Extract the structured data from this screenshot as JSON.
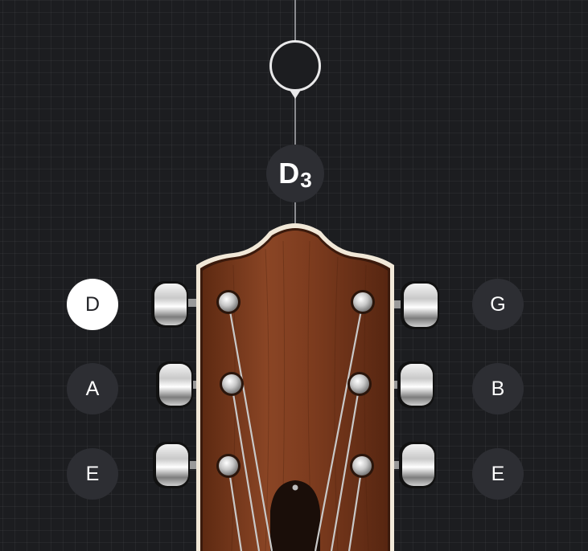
{
  "tuner": {
    "note": "D",
    "octave": "3"
  },
  "strings": {
    "left": [
      {
        "label": "D",
        "selected": true
      },
      {
        "label": "A",
        "selected": false
      },
      {
        "label": "E",
        "selected": false
      }
    ],
    "right": [
      {
        "label": "G",
        "selected": false
      },
      {
        "label": "B",
        "selected": false
      },
      {
        "label": "E",
        "selected": false
      }
    ]
  },
  "colors": {
    "background": "#1c1d20",
    "button": "#2d2e33",
    "button_active": "#ffffff",
    "wood": "#7a3a1c",
    "binding": "#efe6d6"
  },
  "icons": {
    "headstock": "guitar-headstock-icon",
    "tuning_peg": "tuning-peg-icon"
  }
}
